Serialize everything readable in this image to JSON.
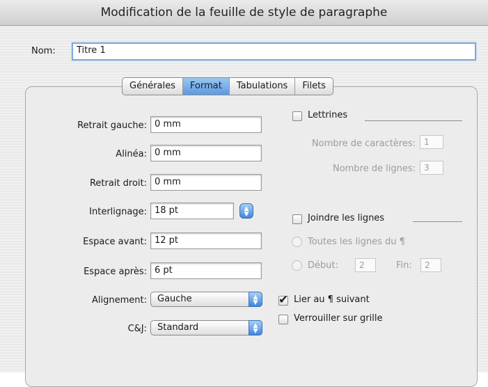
{
  "window": {
    "title": "Modification de la feuille de style de paragraphe"
  },
  "name_field": {
    "label": "Nom:",
    "value": "Titre 1"
  },
  "tabs": [
    {
      "label": "Générales",
      "active": false
    },
    {
      "label": "Format",
      "active": true
    },
    {
      "label": "Tabulations",
      "active": false
    },
    {
      "label": "Filets",
      "active": false
    }
  ],
  "format": {
    "retrait_gauche": {
      "label": "Retrait gauche:",
      "value": "0 mm"
    },
    "alinea": {
      "label": "Alinéa:",
      "value": "0 mm"
    },
    "retrait_droit": {
      "label": "Retrait droit:",
      "value": "0 mm"
    },
    "interlignage": {
      "label": "Interlignage:",
      "value": "18 pt"
    },
    "espace_avant": {
      "label": "Espace avant:",
      "value": "12 pt"
    },
    "espace_apres": {
      "label": "Espace après:",
      "value": "6 pt"
    },
    "alignement": {
      "label": "Alignement:",
      "value": "Gauche"
    },
    "cj": {
      "label": "C&J:",
      "value": "Standard"
    }
  },
  "lettrines": {
    "label": "Lettrines",
    "checked": false,
    "nb_caracteres": {
      "label": "Nombre de caractères:",
      "value": "1"
    },
    "nb_lignes": {
      "label": "Nombre de lignes:",
      "value": "3"
    }
  },
  "joindre": {
    "label": "Joindre les lignes",
    "checked": false,
    "toutes": {
      "label": "Toutes les lignes du ¶"
    },
    "debut": {
      "label": "Début:",
      "value": "2"
    },
    "fin": {
      "label": "Fin:",
      "value": "2"
    }
  },
  "lier": {
    "label": "Lier au ¶ suivant",
    "checked": true
  },
  "verrouiller": {
    "label": "Verrouiller sur grille",
    "checked": false
  },
  "icons": {
    "popup_arrows": "updown-arrows-icon",
    "stepper": "stepper-icon",
    "checkmark": "checkmark-icon"
  },
  "colors": {
    "accent": "#5c9ae0",
    "focus_ring": "#7fa8dc"
  }
}
